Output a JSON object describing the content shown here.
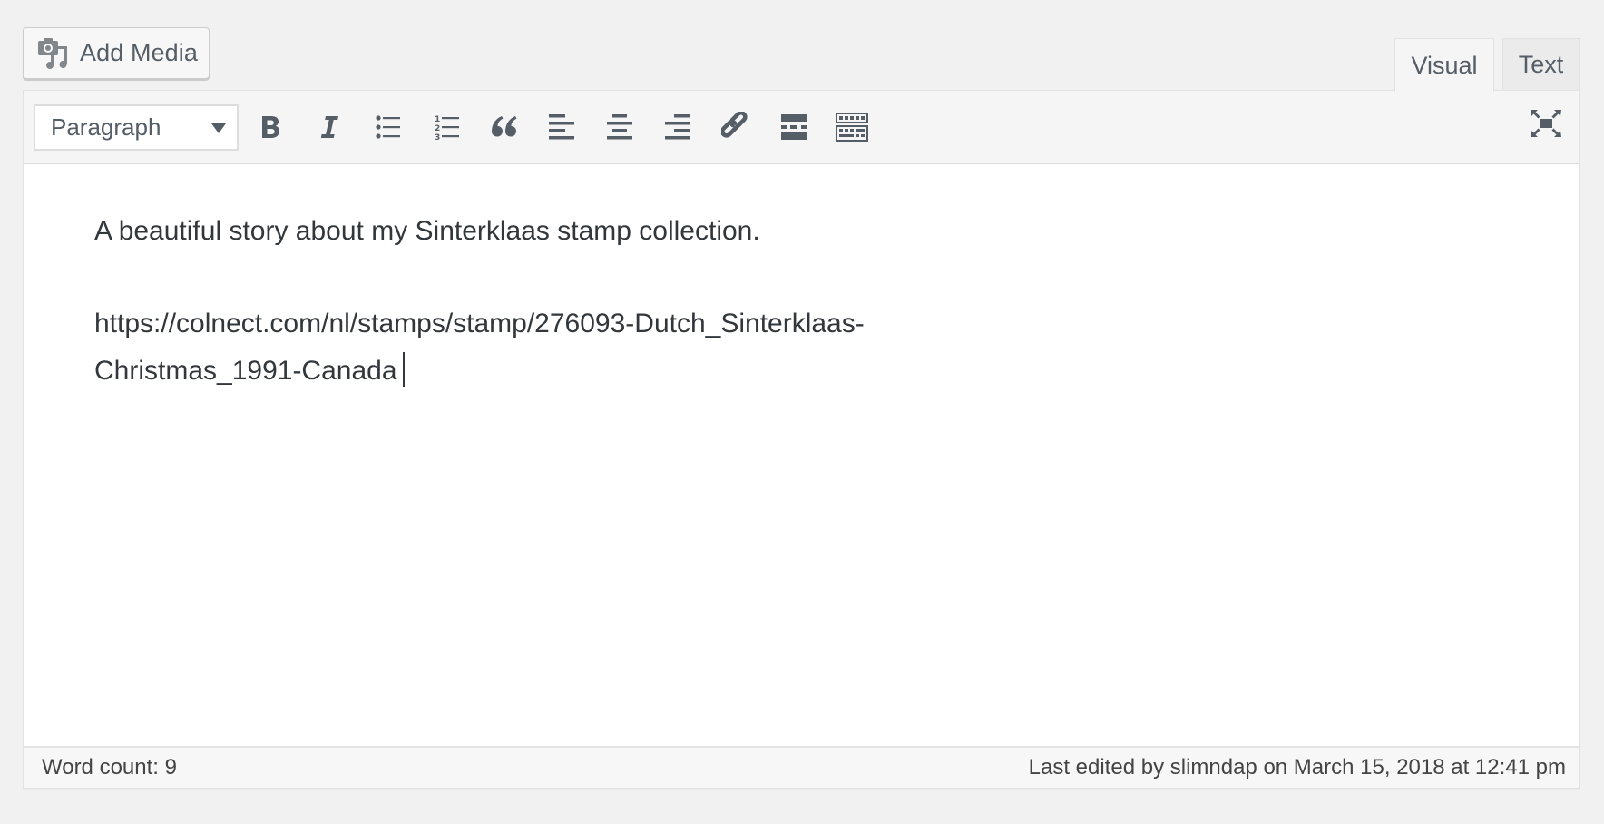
{
  "media_button": {
    "label": "Add Media",
    "icon": "camera-music-icon"
  },
  "tabs": [
    {
      "label": "Visual",
      "active": true
    },
    {
      "label": "Text",
      "active": false
    }
  ],
  "toolbar": {
    "format_select": {
      "value": "Paragraph"
    },
    "buttons": [
      {
        "name": "bold",
        "icon": "bold-icon"
      },
      {
        "name": "italic",
        "icon": "italic-icon"
      },
      {
        "name": "bulleted-list",
        "icon": "bullet-list-icon"
      },
      {
        "name": "numbered-list",
        "icon": "numbered-list-icon"
      },
      {
        "name": "blockquote",
        "icon": "quote-icon"
      },
      {
        "name": "align-left",
        "icon": "align-left-icon"
      },
      {
        "name": "align-center",
        "icon": "align-center-icon"
      },
      {
        "name": "align-right",
        "icon": "align-right-icon"
      },
      {
        "name": "insert-link",
        "icon": "link-icon"
      },
      {
        "name": "read-more",
        "icon": "read-more-icon"
      },
      {
        "name": "toolbar-toggle",
        "icon": "keyboard-icon"
      }
    ],
    "fullscreen": {
      "icon": "fullscreen-icon"
    }
  },
  "content": {
    "paragraphs": [
      "A beautiful story about my Sinterklaas stamp collection.",
      "https://colnect.com/nl/stamps/stamp/276093-Dutch_Sinterklaas-Christmas_1991-Canada"
    ]
  },
  "status": {
    "word_count": "Word count: 9",
    "last_edited": "Last edited by slimndap on March 15, 2018 at 12:41 pm"
  },
  "colors": {
    "icon": "#555d66",
    "text": "#32373c",
    "toolbar_bg": "#f5f5f5",
    "page_bg": "#f1f1f1"
  }
}
